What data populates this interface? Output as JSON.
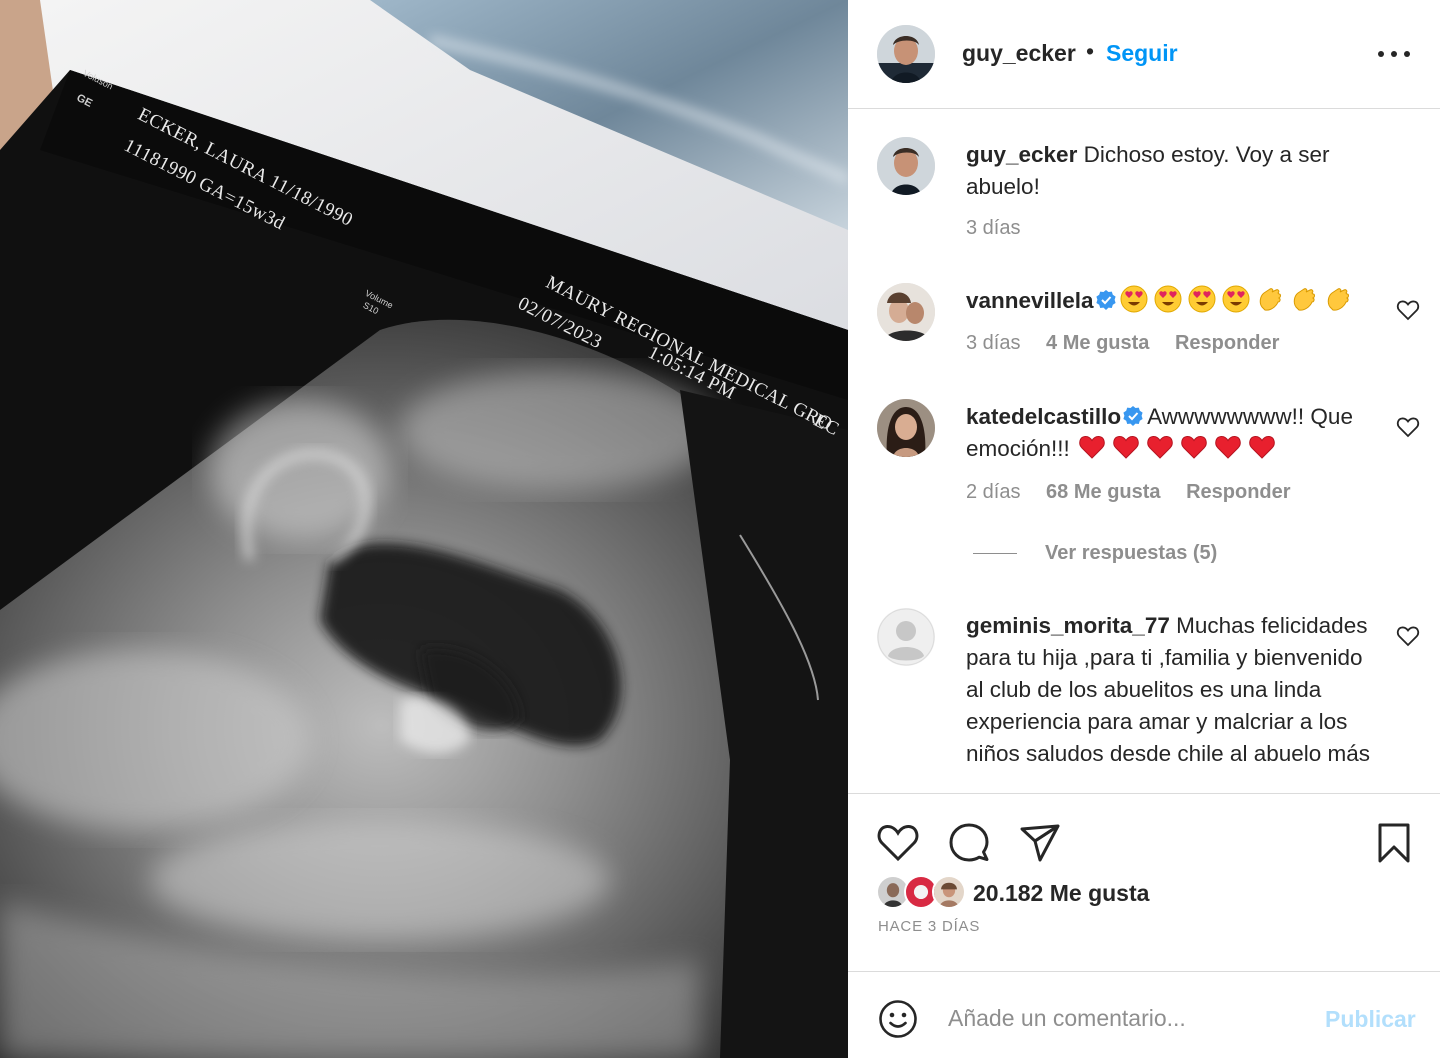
{
  "media": {
    "ultrasound_labels": {
      "patient": "ECKER, LAURA  11/18/1990",
      "patient_id": "11181990   GA=15w3d",
      "facility": "MAURY REGIONAL MEDICAL GRO",
      "date": "02/07/2023",
      "time": "1:05:14 PM",
      "corner": "EC",
      "brand": "Voluson",
      "volume": "Volume",
      "probe": "S10",
      "ge_logo": "GE"
    }
  },
  "header": {
    "username": "guy_ecker",
    "separator": "•",
    "follow_label": "Seguir",
    "more_icon": "more-options-icon"
  },
  "caption": {
    "username": "guy_ecker",
    "text": "Dichoso estoy. Voy a ser abuelo!",
    "time": "3 días"
  },
  "comments": [
    {
      "username": "vannevillela",
      "verified": true,
      "text": "",
      "emojis": [
        "heart-eyes-emoji",
        "heart-eyes-emoji",
        "heart-eyes-emoji",
        "heart-eyes-emoji",
        "clap-emoji",
        "clap-emoji",
        "clap-emoji"
      ],
      "time": "3 días",
      "likes": "4 Me gusta",
      "reply": "Responder"
    },
    {
      "username": "katedelcastillo",
      "verified": true,
      "text": "Awwwwwwww!! Que emoción!!!",
      "emojis": [
        "red-heart-emoji",
        "red-heart-emoji",
        "red-heart-emoji",
        "red-heart-emoji",
        "red-heart-emoji",
        "red-heart-emoji"
      ],
      "time": "2 días",
      "likes": "68 Me gusta",
      "reply": "Responder",
      "view_replies": "Ver respuestas (5)"
    },
    {
      "username": "geminis_morita_77",
      "verified": false,
      "text": "Muchas felicidades para tu hija ,para ti ,familia y bienvenido al club de los abuelitos es una linda experiencia para amar y malcriar a los niños saludos desde chile al abuelo más"
    }
  ],
  "actions": {
    "like_icon": "heart-icon",
    "comment_icon": "comment-icon",
    "share_icon": "paper-plane-icon",
    "save_icon": "bookmark-icon",
    "likes_count": "20.182 Me gusta",
    "time_ago": "HACE 3 DÍAS"
  },
  "add_comment": {
    "placeholder": "Añade un comentario...",
    "publish_label": "Publicar"
  },
  "colors": {
    "accent": "#0095f6",
    "publish_disabled": "#b2dffc",
    "text": "#262626",
    "muted": "#8e8e8e",
    "divider": "#dbdbdb",
    "verified": "#3897f0"
  }
}
